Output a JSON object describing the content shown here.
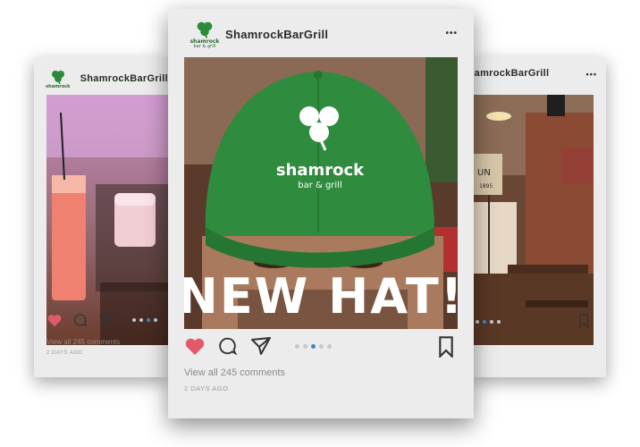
{
  "brand": {
    "username": "ShamrockBarGrill",
    "username_partial": "ShamrockBarGrill",
    "username_right": "ShamrockBarGrill",
    "logo_line1": "shamrock",
    "logo_line2": "bar & grill",
    "accent_green": "#2d8a3a",
    "heart_color": "#e05a6a",
    "pager_active": "#3b86c6"
  },
  "main_post": {
    "overlay_text": "NEW HAT!",
    "hat_logo_line1": "shamrock",
    "hat_logo_line2": "bar & grill",
    "comments": "View all 245 comments",
    "time": "2 DAYS AGO",
    "more": "•••"
  },
  "left_post": {
    "comments": "View all 245 comments",
    "time": "2 DAYS AGO"
  },
  "right_post": {
    "sign_text": "UN",
    "sign_year": "1895"
  },
  "icons": {
    "like": "heart-icon",
    "comment": "comment-icon",
    "share": "share-icon",
    "save": "bookmark-icon",
    "more": "more-icon"
  }
}
